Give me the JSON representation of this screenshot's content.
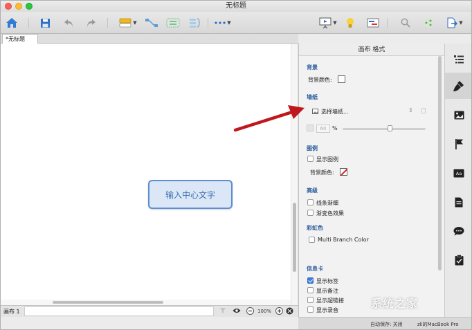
{
  "window": {
    "title": "无标题"
  },
  "tabs": [
    {
      "label": "*无标题"
    }
  ],
  "toolbar": {
    "buttons": [
      {
        "name": "home-button",
        "icon": "home-icon"
      },
      {
        "name": "save-button",
        "icon": "save-icon"
      },
      {
        "name": "undo-button",
        "icon": "undo-icon"
      },
      {
        "name": "redo-button",
        "icon": "redo-icon"
      },
      {
        "name": "topic-button",
        "icon": "topic-icon"
      },
      {
        "name": "relationship-button",
        "icon": "relationship-icon"
      },
      {
        "name": "boundary-button",
        "icon": "boundary-icon"
      },
      {
        "name": "summary-button",
        "icon": "summary-icon"
      },
      {
        "name": "more-button",
        "icon": "more-icon"
      },
      {
        "name": "presentation-button",
        "icon": "presentation-icon"
      },
      {
        "name": "brainstorm-button",
        "icon": "lightbulb-icon"
      },
      {
        "name": "gantt-button",
        "icon": "gantt-icon"
      },
      {
        "name": "search-button",
        "icon": "search-icon"
      },
      {
        "name": "share-button",
        "icon": "share-icon"
      },
      {
        "name": "export-button",
        "icon": "export-icon"
      }
    ],
    "accent": "#3b7ddd"
  },
  "canvas": {
    "central_topic": "输入中心文字",
    "topic_border": "#5b8fd1",
    "topic_fill": "#dbe7f6"
  },
  "statusbar": {
    "sheet_label": "画布 1",
    "zoom": "100%"
  },
  "bottom": {
    "autosave": "自动保存: 关闭",
    "device": "zli的MacBook Pro"
  },
  "panel": {
    "title": "画布 格式",
    "background": {
      "title": "背景",
      "color_label": "背景颜色:"
    },
    "wallpaper": {
      "title": "墙纸",
      "select_label": "选择墙纸...",
      "opacity": "60",
      "percent": "%",
      "opacity_level": 0.6
    },
    "legend": {
      "title": "图例",
      "show_legend": "显示图例",
      "color_label": "背景颜色:"
    },
    "advanced": {
      "title": "高级",
      "tapered_lines": "线条渐细",
      "gradient": "渐变色效果"
    },
    "rainbow": {
      "title": "彩虹色",
      "multi_branch": "Multi Branch Color"
    },
    "info_card": {
      "title": "信息卡",
      "items": [
        {
          "label": "显示标签",
          "checked": true
        },
        {
          "label": "显示备注",
          "checked": false
        },
        {
          "label": "显示超链接",
          "checked": false
        },
        {
          "label": "显示录音",
          "checked": false
        }
      ]
    }
  },
  "rail": {
    "items": [
      {
        "icon": "outline-icon"
      },
      {
        "icon": "format-brush-icon",
        "active": true
      },
      {
        "icon": "image-icon"
      },
      {
        "icon": "flag-icon"
      },
      {
        "icon": "text-style-icon"
      },
      {
        "icon": "notes-icon"
      },
      {
        "icon": "comment-icon"
      },
      {
        "icon": "task-icon"
      }
    ]
  },
  "annotation": {
    "arrow_color": "#c0171c"
  },
  "watermark": "系统之家"
}
